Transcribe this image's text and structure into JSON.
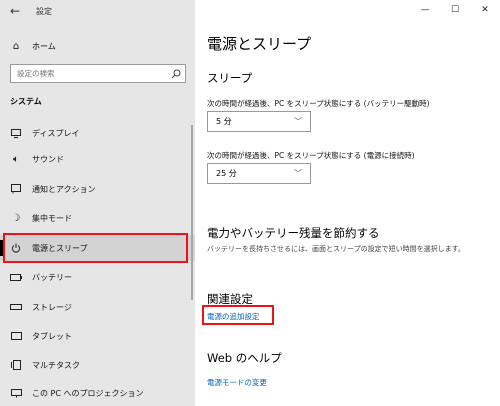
{
  "window": {
    "title": "設定",
    "minimize": "—",
    "maximize": "☐",
    "close": "✕"
  },
  "sidebar": {
    "home_label": "ホーム",
    "search_placeholder": "設定の検索",
    "section_title": "システム",
    "items": [
      {
        "label": "ディスプレイ",
        "icon": "display-icon"
      },
      {
        "label": "サウンド",
        "icon": "sound-icon"
      },
      {
        "label": "通知とアクション",
        "icon": "notification-icon"
      },
      {
        "label": "集中モード",
        "icon": "moon-icon"
      },
      {
        "label": "電源とスリープ",
        "icon": "power-icon",
        "selected": true
      },
      {
        "label": "バッテリー",
        "icon": "battery-icon"
      },
      {
        "label": "ストレージ",
        "icon": "storage-icon"
      },
      {
        "label": "タブレット",
        "icon": "tablet-icon"
      },
      {
        "label": "マルチタスク",
        "icon": "multitask-icon"
      },
      {
        "label": "この PC へのプロジェクション",
        "icon": "projection-icon"
      }
    ]
  },
  "main": {
    "title": "電源とスリープ",
    "sleep_heading": "スリープ",
    "battery_label": "次の時間が経過後、PC をスリープ状態にする (バッテリー駆動時)",
    "battery_value": "5 分",
    "plugged_label": "次の時間が経過後、PC をスリープ状態にする (電源に接続時)",
    "plugged_value": "25 分",
    "save_heading": "電力やバッテリー残量を節約する",
    "save_desc": "バッテリーを長持ちさせるには、画面とスリープの設定で短い時間を選択します。",
    "related_heading": "関連設定",
    "related_link": "電源の追加設定",
    "help_heading": "Web のヘルプ",
    "help_link": "電源モードの変更"
  },
  "colors": {
    "accent_link": "#0067c0",
    "highlight_box": "#e8141b",
    "sidebar_bg": "#e6e6e6"
  }
}
